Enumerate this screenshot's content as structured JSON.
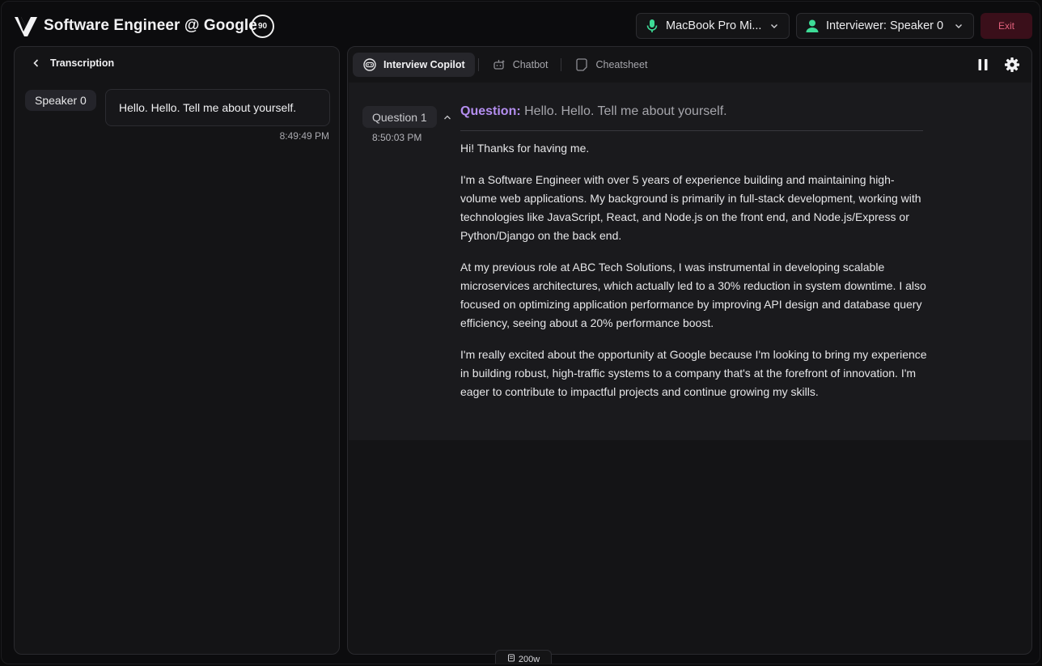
{
  "header": {
    "title": "Software Engineer @ Google",
    "credits": "90",
    "mic_label": "MacBook Pro Mi...",
    "speaker_label": "Interviewer: Speaker 0",
    "exit_label": "Exit",
    "accent_green": "#3ddc97",
    "exit_color": "#e0607b"
  },
  "transcription": {
    "title": "Transcription",
    "messages": [
      {
        "speaker": "Speaker 0",
        "text": "Hello. Hello. Tell me about yourself.",
        "time": "8:49:49 PM"
      }
    ]
  },
  "copilot": {
    "tabs": [
      {
        "label": "Interview Copilot",
        "icon": "copilot-icon",
        "active": true
      },
      {
        "label": "Chatbot",
        "icon": "chatbot-icon",
        "active": false
      },
      {
        "label": "Cheatsheet",
        "icon": "cheatsheet-icon",
        "active": false
      }
    ],
    "question": {
      "chip": "Question 1",
      "time": "8:50:03 PM",
      "label": "Question:",
      "text": "Hello. Hello. Tell me about yourself.",
      "accent": "#b48ef0"
    },
    "answer": [
      "Hi! Thanks for having me.",
      "I'm a Software Engineer with over 5 years of experience building and maintaining high-volume web applications. My background is primarily in full-stack development, working with technologies like JavaScript, React, and Node.js on the front end, and Node.js/Express or Python/Django on the back end.",
      "At my previous role at ABC Tech Solutions, I was instrumental in developing scalable microservices architectures, which actually led to a 30% reduction in system downtime. I also focused on optimizing application performance by improving API design and database query efficiency, seeing about a 20% performance boost.",
      "I'm really excited about the opportunity at Google because I'm looking to bring my experience in building robust, high-traffic systems to a company that's at the forefront of innovation. I'm eager to contribute to impactful projects and continue growing my skills."
    ]
  },
  "footer": {
    "word_count": "200w"
  }
}
